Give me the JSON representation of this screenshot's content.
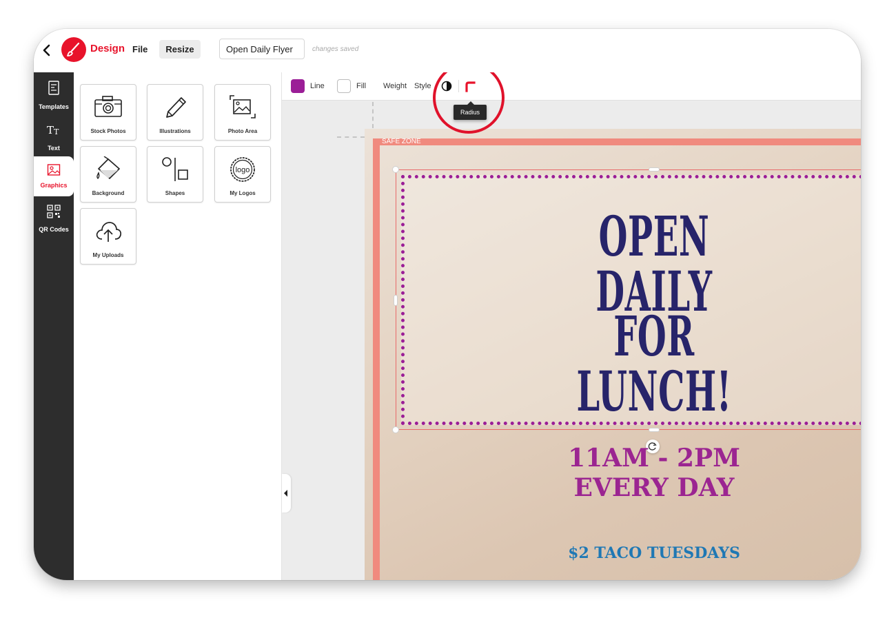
{
  "header": {
    "brand": "Design",
    "menu": {
      "file": "File",
      "resize": "Resize"
    },
    "document_title": "Open Daily Flyer",
    "save_status": "changes saved"
  },
  "sidebar": {
    "items": [
      {
        "label": "Templates",
        "icon": "templates-icon"
      },
      {
        "label": "Text",
        "icon": "text-icon"
      },
      {
        "label": "Graphics",
        "icon": "graphics-icon",
        "active": true
      },
      {
        "label": "QR Codes",
        "icon": "qr-code-icon"
      }
    ]
  },
  "panel": {
    "tiles": [
      {
        "label": "Stock Photos",
        "icon": "camera-icon"
      },
      {
        "label": "Illustrations",
        "icon": "pencil-icon"
      },
      {
        "label": "Photo Area",
        "icon": "photo-area-icon"
      },
      {
        "label": "Background",
        "icon": "paint-bucket-icon"
      },
      {
        "label": "Shapes",
        "icon": "shapes-icon"
      },
      {
        "label": "My Logos",
        "icon": "logo-badge-icon",
        "badge_text": "logo"
      },
      {
        "label": "My Uploads",
        "icon": "cloud-upload-icon"
      }
    ]
  },
  "toolbar": {
    "line_label": "Line",
    "line_color": "#9b1e97",
    "fill_label": "Fill",
    "fill_color": "#ffffff",
    "weight_label": "Weight",
    "style_label": "Style",
    "tooltip": "Radius"
  },
  "canvas": {
    "safe_zone_label": "SAFE ZONE",
    "headline_line1": "OPEN DAILY",
    "headline_line2": "FOR LUNCH!",
    "hours_line1": "11AM - 2PM",
    "hours_line2": "EVERY DAY",
    "promo": "$2 TACO TUESDAYS"
  },
  "colors": {
    "accent": "#e8132b",
    "headline": "#27246a",
    "hours": "#9b2591",
    "promo": "#1f78b4",
    "bleed": "#f08a7e"
  }
}
